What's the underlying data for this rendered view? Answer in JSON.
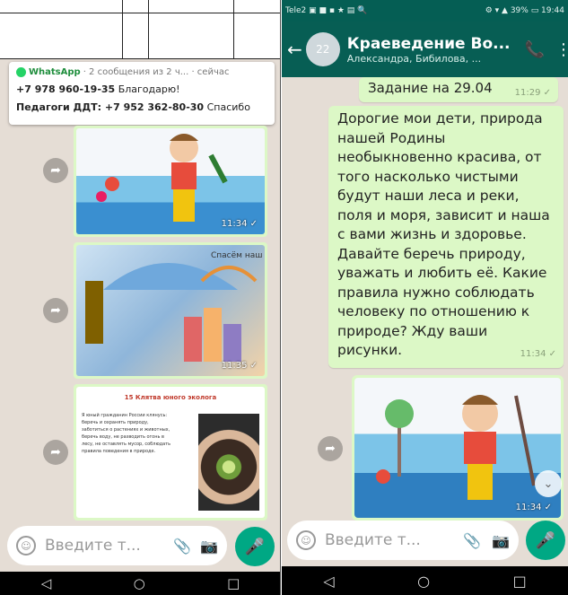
{
  "left": {
    "notification": {
      "app": "WhatsApp",
      "summary": "· 2 сообщения из 2 ч... · сейчас",
      "line1_sender": "+7 978 960-19-35",
      "line1_text": "Благодарю!",
      "line2_sender": "Педагоги ДДТ: +7 952 362-80-30",
      "line2_text": "Спасибо"
    },
    "images": [
      {
        "time": "11:34 ✓"
      },
      {
        "time": "11:35 ✓",
        "caption": "Спасём наш мир"
      },
      {
        "time": ""
      }
    ],
    "slide": {
      "title": "15 Клятва юного эколога",
      "text": "Я юный гражданин России клянусь: беречь и охранять природу, заботиться о растениях и животных, беречь воду, не разводить огонь в лесу, не оставлять мусор, соблюдать правила поведения в природе."
    },
    "input_placeholder": "Введите т...",
    "nav": [
      "◁",
      "○",
      "□"
    ]
  },
  "right": {
    "status": {
      "left": "Tele2 ▣ ■ ▪ ★ ▤ 🔍",
      "right": "⚙ ▾ ▲ 39% ▭ 19:44"
    },
    "header": {
      "avatar_text": "22",
      "title": "Краеведение Во...",
      "subtitle": "Александра, Бибилова, ...",
      "call_icon": "add-call-icon",
      "menu_icon": "more-vert-icon"
    },
    "task": {
      "text": "Задание на 29.04",
      "time": "11:29 ✓"
    },
    "message": {
      "text": "Дорогие мои дети, природа нашей Родины необыкновенно красива, от того насколько чистыми будут наши леса и реки, поля и моря, зависит и наша с вами жизнь и здоровье. Давайте беречь природу, уважать и любить её. Какие правила нужно соблюдать человеку по отношению к природе? Жду ваши рисунки.",
      "time": "11:34 ✓"
    },
    "image": {
      "time": "11:34 ✓"
    },
    "input_placeholder": "Введите т...",
    "nav": [
      "◁",
      "○",
      "□"
    ]
  },
  "colors": {
    "header": "#075e54",
    "bubble": "#dcf8c6",
    "background": "#e5ddd5",
    "accent": "#00a884"
  }
}
